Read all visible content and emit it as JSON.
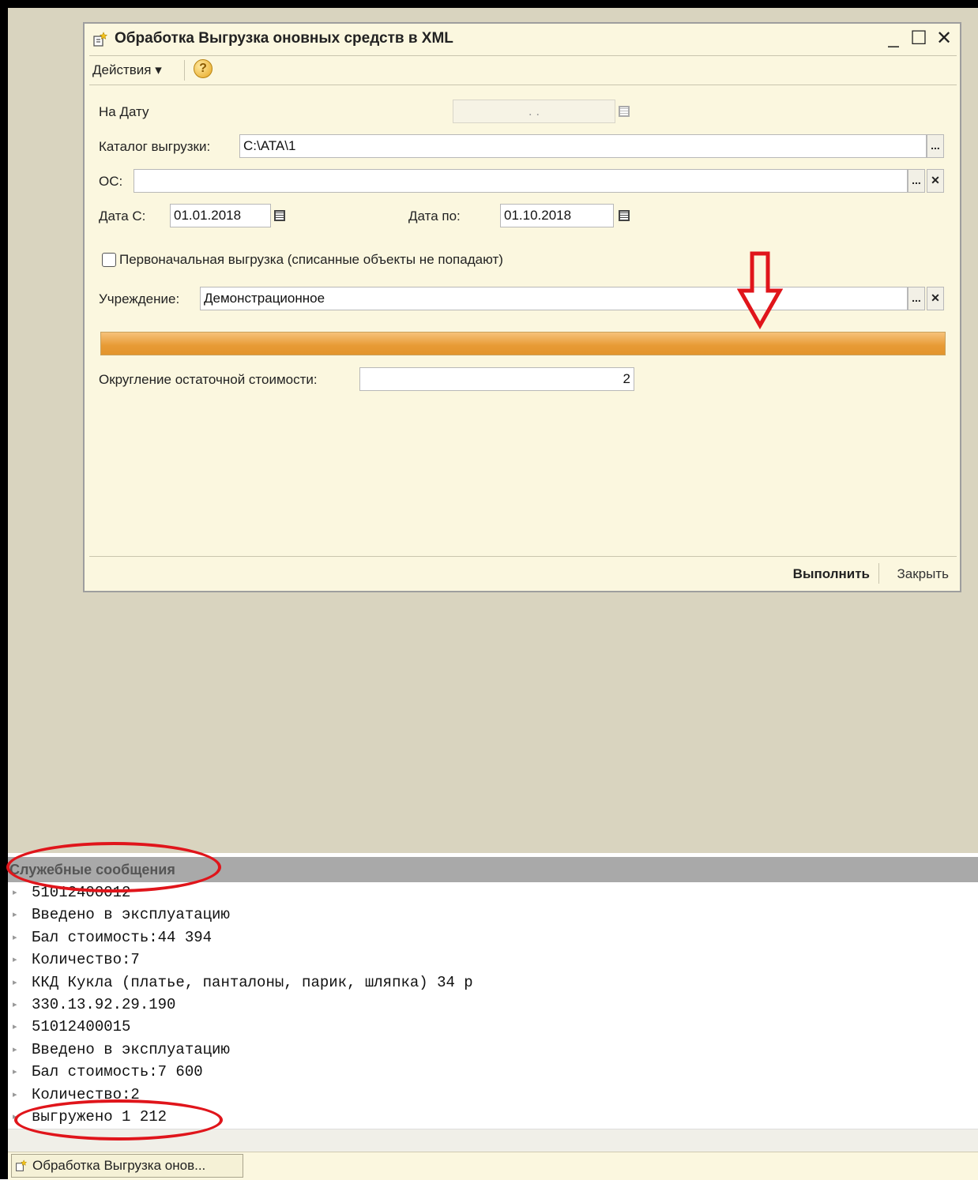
{
  "window": {
    "title": "Обработка  Выгрузка оновных средств в XML",
    "controls": {
      "minimize": "_",
      "maximize": "☐",
      "close": "✕"
    }
  },
  "toolbar": {
    "actions_label": "Действия ▾",
    "help_icon": "?"
  },
  "form": {
    "on_date_label": "На Дату",
    "on_date_value": ". .",
    "catalog_label": "Каталог выгрузки:",
    "catalog_value": "C:\\ATA\\1",
    "os_label": "ОС:",
    "os_value": "",
    "date_from_label": "Дата С:",
    "date_from_value": "01.01.2018",
    "date_to_label": "Дата по:",
    "date_to_value": "01.10.2018",
    "initial_export_label": "Первоначальная выгрузка (списанные объекты не попадают)",
    "initial_export_checked": false,
    "institution_label": "Учреждение:",
    "institution_value": "Демонстрационное",
    "progress_percent": 100,
    "rounding_label": "Округление остаточной стоимости:",
    "rounding_value": "2",
    "select_button": "...",
    "clear_button": "✕"
  },
  "buttons": {
    "run": "Выполнить",
    "close": "Закрыть"
  },
  "messages": {
    "title": "Служебные сообщения",
    "lines": [
      "51012400012",
      "Введено в эксплуатацию",
      "Бал стоимость:44 394",
      "Количество:7",
      "ККД Кукла (платье, панталоны, парик, шляпка) 34 р",
      "330.13.92.29.190",
      "51012400015",
      "Введено в эксплуатацию",
      "Бал стоимость:7 600",
      "Количество:2",
      "выгружено 1 212"
    ]
  },
  "taskbar": {
    "item": "Обработка  Выгрузка онов..."
  },
  "colors": {
    "annotation": "#e0151b",
    "progress": "#e79a35",
    "window_bg": "#fbf7df",
    "desktop": "#d9d4bf"
  }
}
